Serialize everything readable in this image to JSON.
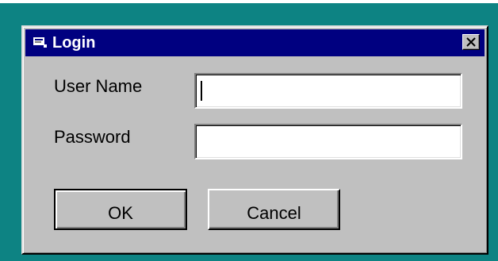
{
  "window": {
    "title": "Login",
    "icon": "app-icon",
    "close_icon": "close-icon"
  },
  "form": {
    "username_label": "User Name",
    "username_value": "",
    "password_label": "Password",
    "password_value": ""
  },
  "buttons": {
    "ok_label": "OK",
    "cancel_label": "Cancel"
  },
  "colors": {
    "desktop": "#0d8383",
    "titlebar": "#000080",
    "window_face": "#c0c0c0"
  }
}
